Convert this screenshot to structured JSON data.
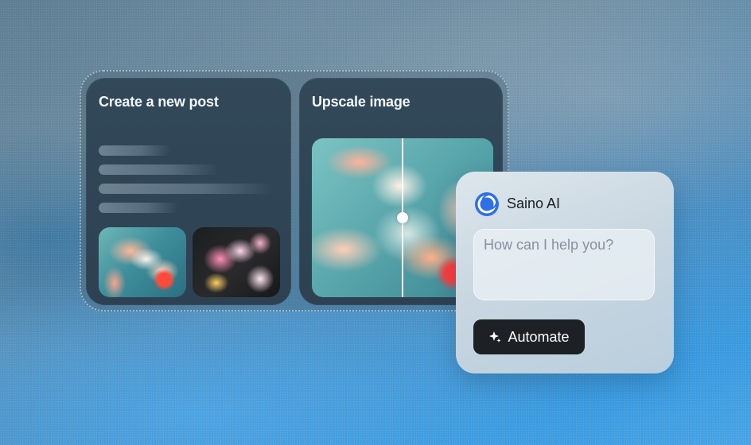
{
  "post_card": {
    "title": "Create a new post"
  },
  "upscale_card": {
    "title": "Upscale image"
  },
  "assistant": {
    "name": "Saino AI",
    "input_placeholder": "How can I help you?",
    "action_label": "Automate",
    "brand_color": "#2f6fe8",
    "button_color": "#1d2024"
  }
}
